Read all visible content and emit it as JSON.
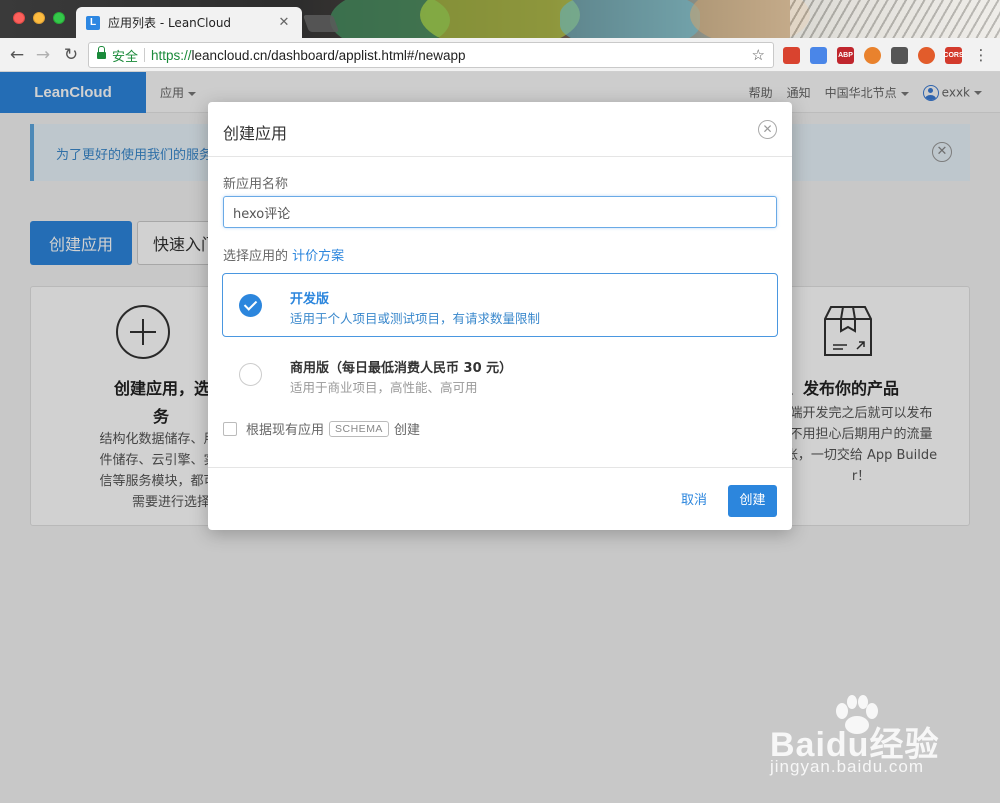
{
  "browser": {
    "tab_title": "应用列表 - LeanCloud",
    "tab_favicon": "L",
    "tab_close": "✕",
    "secure_label": "安全",
    "url_scheme": "https://",
    "url_rest": "leancloud.cn/dashboard/applist.html#/newapp",
    "extensions": [
      {
        "name": "calendar-ext-icon",
        "label": "",
        "color": "#d9432f"
      },
      {
        "name": "translate-ext-icon",
        "label": "",
        "color": "#4a86e8"
      },
      {
        "name": "adblock-ext-icon",
        "label": "ABP",
        "color": "#c0262d"
      },
      {
        "name": "color-ext-icon",
        "label": "",
        "color": "#e9822d"
      },
      {
        "name": "monitor-ext-icon",
        "label": "",
        "color": "#555555"
      },
      {
        "name": "cancel-ext-icon",
        "label": "",
        "color": "#e25c2b"
      },
      {
        "name": "cors-ext-icon",
        "label": "CORS",
        "color": "#d33a2c"
      }
    ]
  },
  "appnav": {
    "brand": "LeanCloud",
    "app_menu": "应用",
    "help": "帮助",
    "notify": "通知",
    "region": "中国华北节点",
    "user": "exxk"
  },
  "notice": {
    "text": "为了更好的使用我们的服务",
    "close": "✕"
  },
  "actions": {
    "create_app": "创建应用",
    "quick_entry": "快速入门"
  },
  "cards": {
    "left": {
      "title_line1": "创建应用，选择需要",
      "title_line2": "务",
      "desc": [
        "结构化数据储存、用户注",
        "件储存、云引擎、实时聊",
        "信等服务模块，都可以根",
        "需要进行选择"
      ]
    },
    "right": {
      "title": "线、发布你的产品",
      "desc": [
        "端开发完之后就可以发布",
        "不用担心后期用户的流量",
        "张，一切交给 App Builde",
        "r！"
      ]
    }
  },
  "modal": {
    "title": "创建应用",
    "close": "✕",
    "name_label": "新应用名称",
    "name_value": "hexo评论",
    "plan_label": "选择应用的",
    "plan_link": "计价方案",
    "plans": [
      {
        "name": "开发版",
        "desc": "适用于个人项目或测试项目，有请求数量限制",
        "selected": true
      },
      {
        "name": "商用版（每日最低消费人民币 30 元）",
        "desc": "适用于商业项目，高性能、高可用",
        "selected": false
      }
    ],
    "schema_prefix": "根据现有应用",
    "schema_tag": "SCHEMA",
    "schema_suffix": "创建",
    "cancel": "取消",
    "create": "创建"
  },
  "watermark": {
    "main": "Baidu经验",
    "sub": "jingyan.baidu.com"
  },
  "colors": {
    "primary": "#2c86dd",
    "secure_green": "#1a8a3a",
    "notice_bg": "#e8f3fb"
  }
}
